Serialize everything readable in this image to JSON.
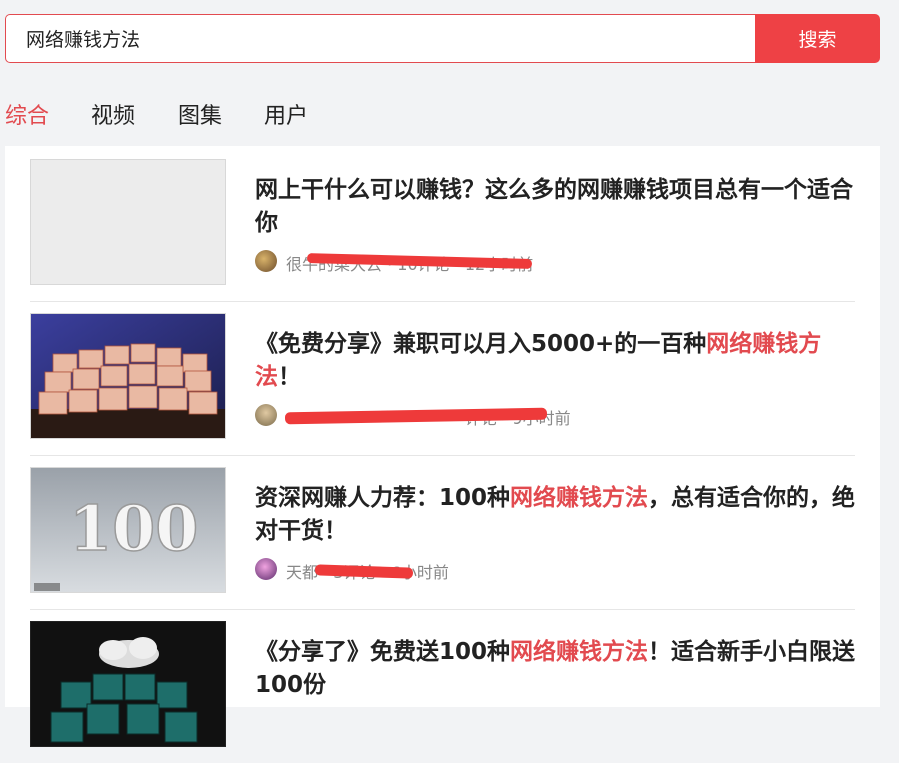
{
  "search": {
    "value": "网络赚钱方法",
    "button_label": "搜索"
  },
  "tabs": [
    {
      "label": "综合",
      "active": true
    },
    {
      "label": "视频",
      "active": false
    },
    {
      "label": "图集",
      "active": false
    },
    {
      "label": "用户",
      "active": false
    }
  ],
  "results": [
    {
      "title_parts": [
        "网上干什么可以赚钱？这么多的网赚赚钱项目总有一个适合你"
      ],
      "meta": "很牛的菜大云 · 10评论 · 12小时前"
    },
    {
      "title_parts": [
        "《免费分享》兼职可以月入5000+的一百种",
        "网络赚钱方法",
        "！"
      ],
      "meta": "· 评论 · 9小时前"
    },
    {
      "title_parts": [
        "资深网赚人力荐：100种",
        "网络赚钱方法",
        "，总有适合你的，绝对干货！"
      ],
      "meta": "天都 · 3评论 · 6小时前"
    },
    {
      "title_parts": [
        "《分享了》免费送100种",
        "网络赚钱方法",
        "！适合新手小白限送100份"
      ],
      "meta": ""
    }
  ],
  "colors": {
    "accent": "#e24a4f",
    "button": "#ee4145"
  }
}
